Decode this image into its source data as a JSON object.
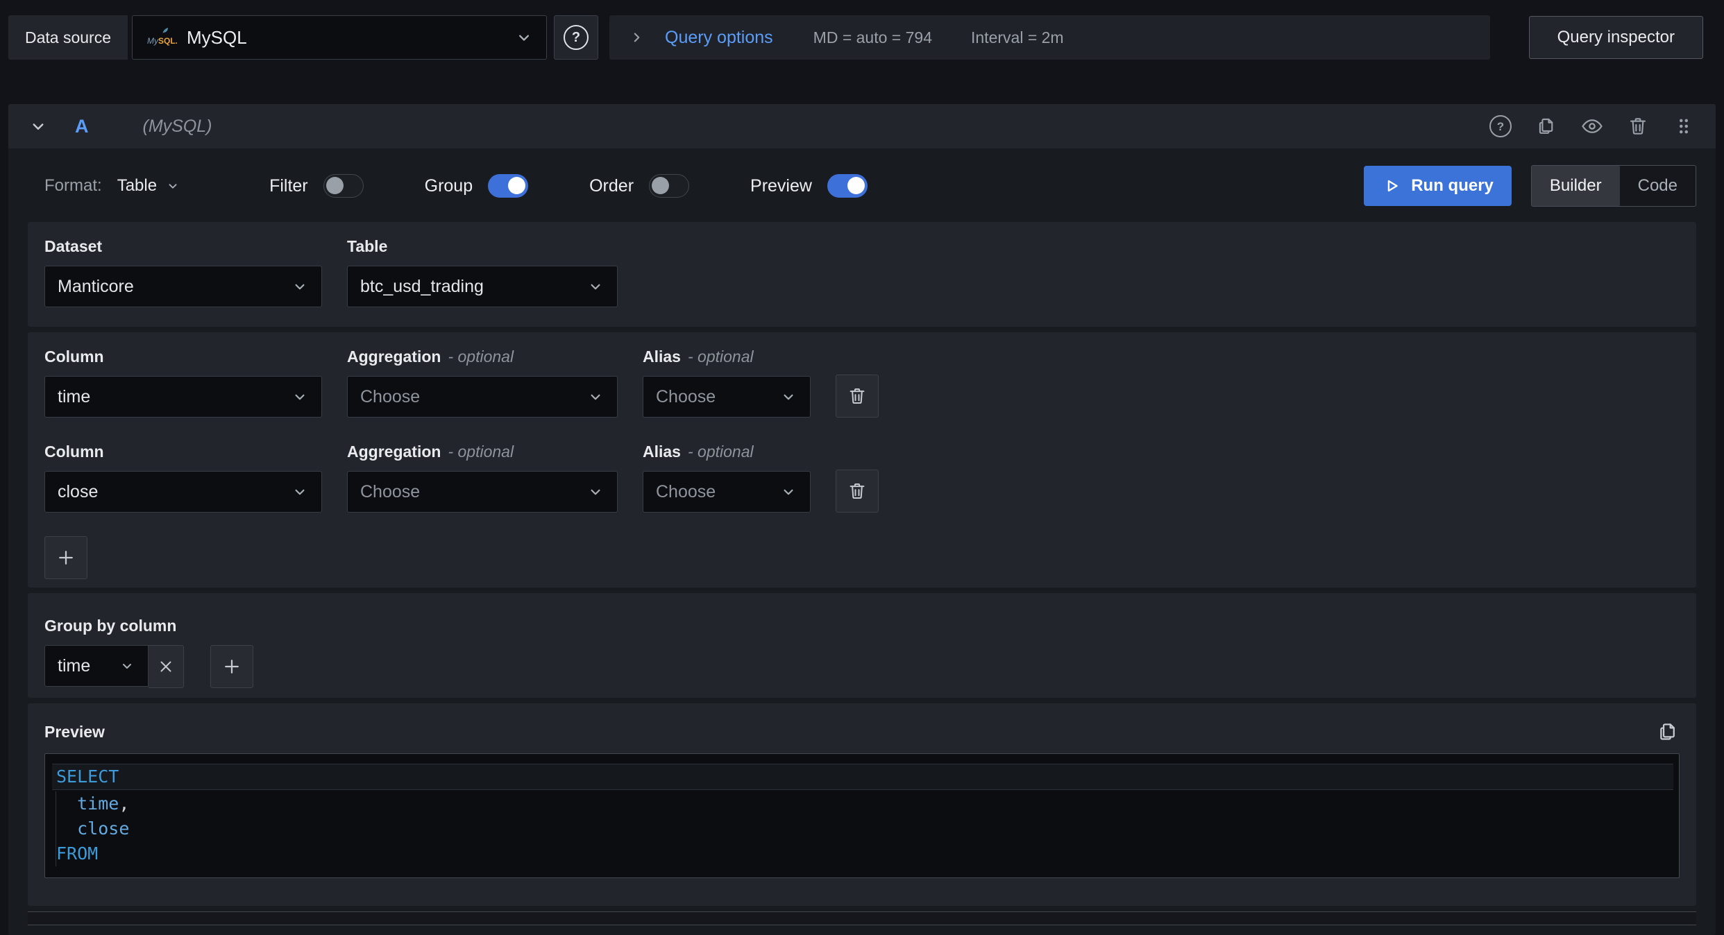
{
  "topbar": {
    "datasource_label": "Data source",
    "datasource_value": "MySQL",
    "query_options_label": "Query options",
    "max_data_points": "MD = auto = 794",
    "interval": "Interval = 2m",
    "query_inspector_label": "Query inspector"
  },
  "query_header": {
    "ref_id": "A",
    "datasource_hint": "(MySQL)",
    "icons": [
      "question-circle-icon",
      "copy-icon",
      "eye-icon",
      "trash-icon",
      "drag-handle-icon"
    ]
  },
  "toolbar": {
    "format_label": "Format:",
    "format_value": "Table",
    "toggles": [
      {
        "label": "Filter",
        "on": false
      },
      {
        "label": "Group",
        "on": true
      },
      {
        "label": "Order",
        "on": false
      },
      {
        "label": "Preview",
        "on": true
      }
    ],
    "run_query_label": "Run query",
    "modes": {
      "builder": "Builder",
      "code": "Code",
      "active": "Builder"
    }
  },
  "builder": {
    "dataset": {
      "label": "Dataset",
      "value": "Manticore"
    },
    "table": {
      "label": "Table",
      "value": "btc_usd_trading"
    },
    "column_rows": [
      {
        "column_label": "Column",
        "column_value": "time",
        "aggregation_label": "Aggregation",
        "aggregation_optional": "- optional",
        "aggregation_placeholder": "Choose",
        "alias_label": "Alias",
        "alias_optional": "- optional",
        "alias_placeholder": "Choose"
      },
      {
        "column_label": "Column",
        "column_value": "close",
        "aggregation_label": "Aggregation",
        "aggregation_optional": "- optional",
        "aggregation_placeholder": "Choose",
        "alias_label": "Alias",
        "alias_optional": "- optional",
        "alias_placeholder": "Choose"
      }
    ],
    "group_by": {
      "label": "Group by column",
      "value": "time"
    }
  },
  "preview": {
    "label": "Preview",
    "sql": "SELECT\n  time,\n  close\nFROM",
    "sql_lines": [
      {
        "highlight": true,
        "tokens": [
          {
            "text": "SELECT",
            "type": "keyword"
          }
        ]
      },
      {
        "highlight": false,
        "tokens": [
          {
            "text": "  ",
            "type": "plain"
          },
          {
            "text": "time",
            "type": "identifier"
          },
          {
            "text": ",",
            "type": "plain"
          }
        ]
      },
      {
        "highlight": false,
        "tokens": [
          {
            "text": "  ",
            "type": "plain"
          },
          {
            "text": "close",
            "type": "identifier"
          }
        ]
      },
      {
        "highlight": false,
        "tokens": [
          {
            "text": "FROM",
            "type": "keyword"
          }
        ]
      }
    ]
  },
  "colors": {
    "accent_blue": "#3D71D9",
    "run_button_blue": "#3B73D9",
    "link_blue": "#5B9DF8",
    "sql_keyword_blue": "#3D9BD9",
    "sql_identifier_blue": "#64A9E0",
    "section_bg": "#22252B",
    "card_bg": "#181B1F",
    "page_bg": "#111318",
    "input_bg": "#0B0D10",
    "text_secondary": "#9AA0A7"
  }
}
